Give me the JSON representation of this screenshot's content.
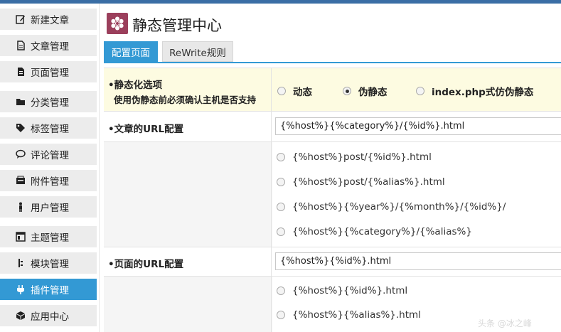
{
  "sidebar": {
    "items": [
      {
        "label": "新建文章",
        "icon": "edit-icon"
      },
      {
        "label": "文章管理",
        "icon": "document-icon"
      },
      {
        "label": "页面管理",
        "icon": "page-icon"
      },
      {
        "label": "分类管理",
        "icon": "folder-icon"
      },
      {
        "label": "标签管理",
        "icon": "tag-icon"
      },
      {
        "label": "评论管理",
        "icon": "comment-icon"
      },
      {
        "label": "附件管理",
        "icon": "attachment-icon"
      },
      {
        "label": "用户管理",
        "icon": "user-icon"
      },
      {
        "label": "主题管理",
        "icon": "theme-icon"
      },
      {
        "label": "模块管理",
        "icon": "module-icon"
      },
      {
        "label": "插件管理",
        "icon": "plugin-icon",
        "active": true
      },
      {
        "label": "应用中心",
        "icon": "app-center-icon"
      }
    ],
    "active_color": "#3399d4"
  },
  "header": {
    "title": "静态管理中心",
    "icon_color": "#9b3f5c"
  },
  "tabs": [
    {
      "label": "配置页面",
      "active": true
    },
    {
      "label": "ReWrite规则",
      "active": false
    }
  ],
  "settings": {
    "mode": {
      "label": "•静态化选项",
      "note": "使用伪静态前必须确认主机是否支持",
      "options": [
        {
          "label": "动态",
          "checked": false
        },
        {
          "label": "伪静态",
          "checked": true
        },
        {
          "label": "index.php式仿伪静态",
          "checked": false
        }
      ]
    },
    "article_url": {
      "label": "•文章的URL配置",
      "value": "{%host%}{%category%}/{%id%}.html",
      "presets": [
        "{%host%}post/{%id%}.html",
        "{%host%}post/{%alias%}.html",
        "{%host%}{%year%}/{%month%}/{%id%}/",
        "{%host%}{%category%}/{%alias%}"
      ]
    },
    "page_url": {
      "label": "•页面的URL配置",
      "value": "{%host%}{%id%}.html",
      "presets": [
        "{%host%}{%id%}.html",
        "{%host%}{%alias%}.html"
      ]
    }
  },
  "watermark": "头条 @冰之峰"
}
